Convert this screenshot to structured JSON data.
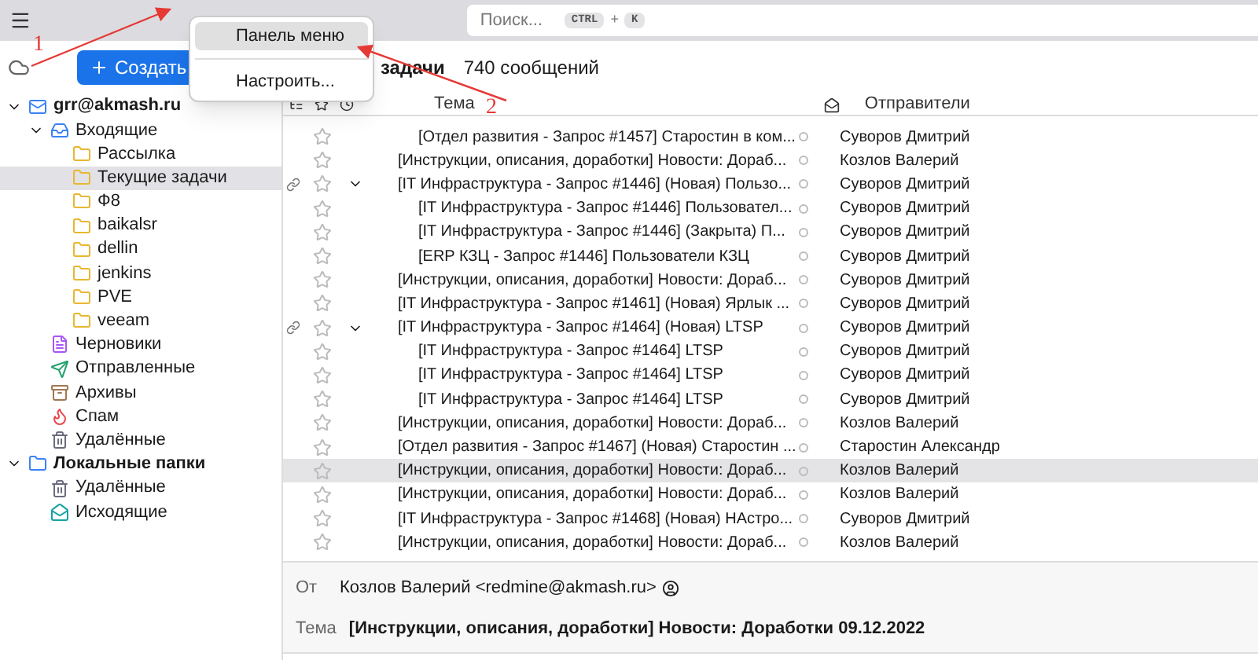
{
  "toolbar": {
    "search": {
      "placeholder": "Поиск...",
      "keys": [
        "CTRL",
        "+",
        "K"
      ]
    },
    "new_button": "Создать"
  },
  "context_menu": {
    "items": [
      {
        "label": "Панель меню",
        "selected": true
      },
      {
        "label": "Настроить...",
        "selected": false
      }
    ]
  },
  "folder_header": {
    "title": "задачи",
    "count": "740 сообщений"
  },
  "sidebar": {
    "items": [
      {
        "label": "grr@akmash.ru",
        "kind": "account",
        "bold": true,
        "expanded": true,
        "selected": false,
        "children": [
          {
            "label": "Входящие",
            "kind": "inbox",
            "bold": false,
            "expanded": true,
            "selected": false,
            "children": [
              {
                "label": "Рассылка",
                "kind": "folder",
                "bold": false,
                "selected": false
              },
              {
                "label": "Текущие задачи",
                "kind": "folder",
                "bold": false,
                "selected": true
              },
              {
                "label": "Ф8",
                "kind": "folder",
                "bold": false,
                "selected": false
              },
              {
                "label": "baikalsr",
                "kind": "folder",
                "bold": false,
                "selected": false
              },
              {
                "label": "dellin",
                "kind": "folder",
                "bold": false,
                "selected": false
              },
              {
                "label": "jenkins",
                "kind": "folder",
                "bold": false,
                "selected": false
              },
              {
                "label": "PVE",
                "kind": "folder",
                "bold": false,
                "selected": false
              },
              {
                "label": "veeam",
                "kind": "folder",
                "bold": false,
                "selected": false
              }
            ]
          },
          {
            "label": "Черновики",
            "kind": "drafts",
            "bold": false,
            "selected": false
          },
          {
            "label": "Отправленные",
            "kind": "sent",
            "bold": false,
            "selected": false
          },
          {
            "label": "Архивы",
            "kind": "archive",
            "bold": false,
            "selected": false
          },
          {
            "label": "Спам",
            "kind": "spam",
            "bold": false,
            "selected": false
          },
          {
            "label": "Удалённые",
            "kind": "trash",
            "bold": false,
            "selected": false
          }
        ]
      },
      {
        "label": "Локальные папки",
        "kind": "local",
        "bold": true,
        "expanded": true,
        "selected": false,
        "children": [
          {
            "label": "Удалённые",
            "kind": "trash",
            "bold": false,
            "selected": false
          },
          {
            "label": "Исходящие",
            "kind": "outbox",
            "bold": false,
            "selected": false
          }
        ]
      }
    ]
  },
  "message_list": {
    "columns": {
      "subject": "Тема",
      "senders": "Отправители"
    },
    "rows": [
      {
        "subject": "[Отдел развития - Запрос #1457] Старостин в ком...",
        "sender": "Суворов Дмитрий",
        "child": true,
        "thread": false,
        "selected": false
      },
      {
        "subject": "[Инструкции, описания, доработки] Новости: Дораб...",
        "sender": "Козлов Валерий",
        "child": false,
        "thread": false,
        "selected": false
      },
      {
        "subject": "[IT Инфраструктура - Запрос #1446] (Новая) Пользо...",
        "sender": "Суворов Дмитрий",
        "child": false,
        "thread": true,
        "selected": false
      },
      {
        "subject": "[IT Инфраструктура - Запрос #1446] Пользовател...",
        "sender": "Суворов Дмитрий",
        "child": true,
        "thread": false,
        "selected": false
      },
      {
        "subject": "[IT Инфраструктура - Запрос #1446] (Закрыта) П...",
        "sender": "Суворов Дмитрий",
        "child": true,
        "thread": false,
        "selected": false
      },
      {
        "subject": "[ERP КЗЦ - Запрос #1446] Пользователи КЗЦ",
        "sender": "Суворов Дмитрий",
        "child": true,
        "thread": false,
        "selected": false
      },
      {
        "subject": "[Инструкции, описания, доработки] Новости: Дораб...",
        "sender": "Суворов Дмитрий",
        "child": false,
        "thread": false,
        "selected": false
      },
      {
        "subject": "[IT Инфраструктура - Запрос #1461] (Новая) Ярлык ...",
        "sender": "Суворов Дмитрий",
        "child": false,
        "thread": false,
        "selected": false
      },
      {
        "subject": "[IT Инфраструктура - Запрос #1464] (Новая) LTSP",
        "sender": "Суворов Дмитрий",
        "child": false,
        "thread": true,
        "selected": false
      },
      {
        "subject": "[IT Инфраструктура - Запрос #1464] LTSP",
        "sender": "Суворов Дмитрий",
        "child": true,
        "thread": false,
        "selected": false
      },
      {
        "subject": "[IT Инфраструктура - Запрос #1464] LTSP",
        "sender": "Суворов Дмитрий",
        "child": true,
        "thread": false,
        "selected": false
      },
      {
        "subject": "[IT Инфраструктура - Запрос #1464] LTSP",
        "sender": "Суворов Дмитрий",
        "child": true,
        "thread": false,
        "selected": false
      },
      {
        "subject": "[Инструкции, описания, доработки] Новости: Дораб...",
        "sender": "Козлов Валерий",
        "child": false,
        "thread": false,
        "selected": false
      },
      {
        "subject": "[Отдел развития - Запрос #1467] (Новая) Старостин ...",
        "sender": "Старостин Александр",
        "child": false,
        "thread": false,
        "selected": false
      },
      {
        "subject": "[Инструкции, описания, доработки] Новости: Дораб...",
        "sender": "Козлов Валерий",
        "child": false,
        "thread": false,
        "selected": true
      },
      {
        "subject": "[Инструкции, описания, доработки] Новости: Дораб...",
        "sender": "Козлов Валерий",
        "child": false,
        "thread": false,
        "selected": false
      },
      {
        "subject": "[IT Инфраструктура - Запрос #1468] (Новая) НАстро...",
        "sender": "Суворов Дмитрий",
        "child": false,
        "thread": false,
        "selected": false
      },
      {
        "subject": "[Инструкции, описания, доработки] Новости: Дораб...",
        "sender": "Козлов Валерий",
        "child": false,
        "thread": false,
        "selected": false
      }
    ]
  },
  "preview": {
    "from_label": "От",
    "from": "Козлов Валерий <redmine@akmash.ru>",
    "subject_label": "Тема",
    "subject": "[Инструкции, описания, доработки] Новости: Доработки 09.12.2022"
  },
  "annotations": [
    {
      "label": "1"
    },
    {
      "label": "2"
    }
  ]
}
